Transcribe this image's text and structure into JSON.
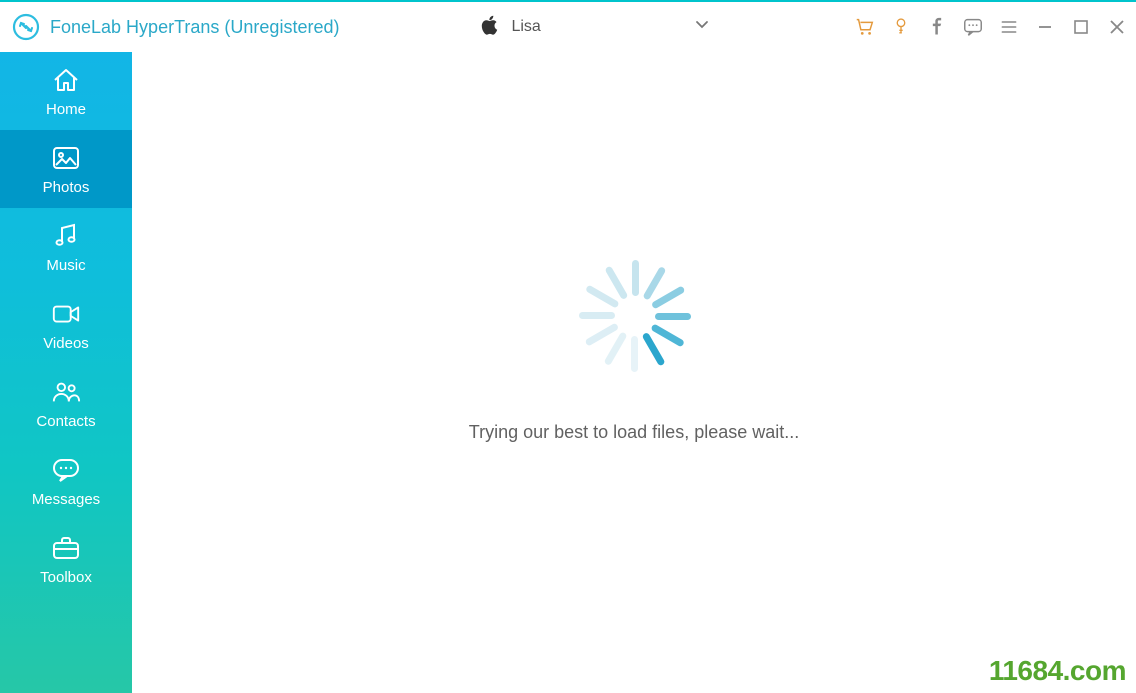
{
  "header": {
    "app_title": "FoneLab HyperTrans (Unregistered)",
    "device_name": "Lisa"
  },
  "sidebar": {
    "items": [
      {
        "label": "Home"
      },
      {
        "label": "Photos"
      },
      {
        "label": "Music"
      },
      {
        "label": "Videos"
      },
      {
        "label": "Contacts"
      },
      {
        "label": "Messages"
      },
      {
        "label": "Toolbox"
      }
    ]
  },
  "content": {
    "status_text": "Trying our best to load files, please wait..."
  },
  "watermark": "11684.com"
}
